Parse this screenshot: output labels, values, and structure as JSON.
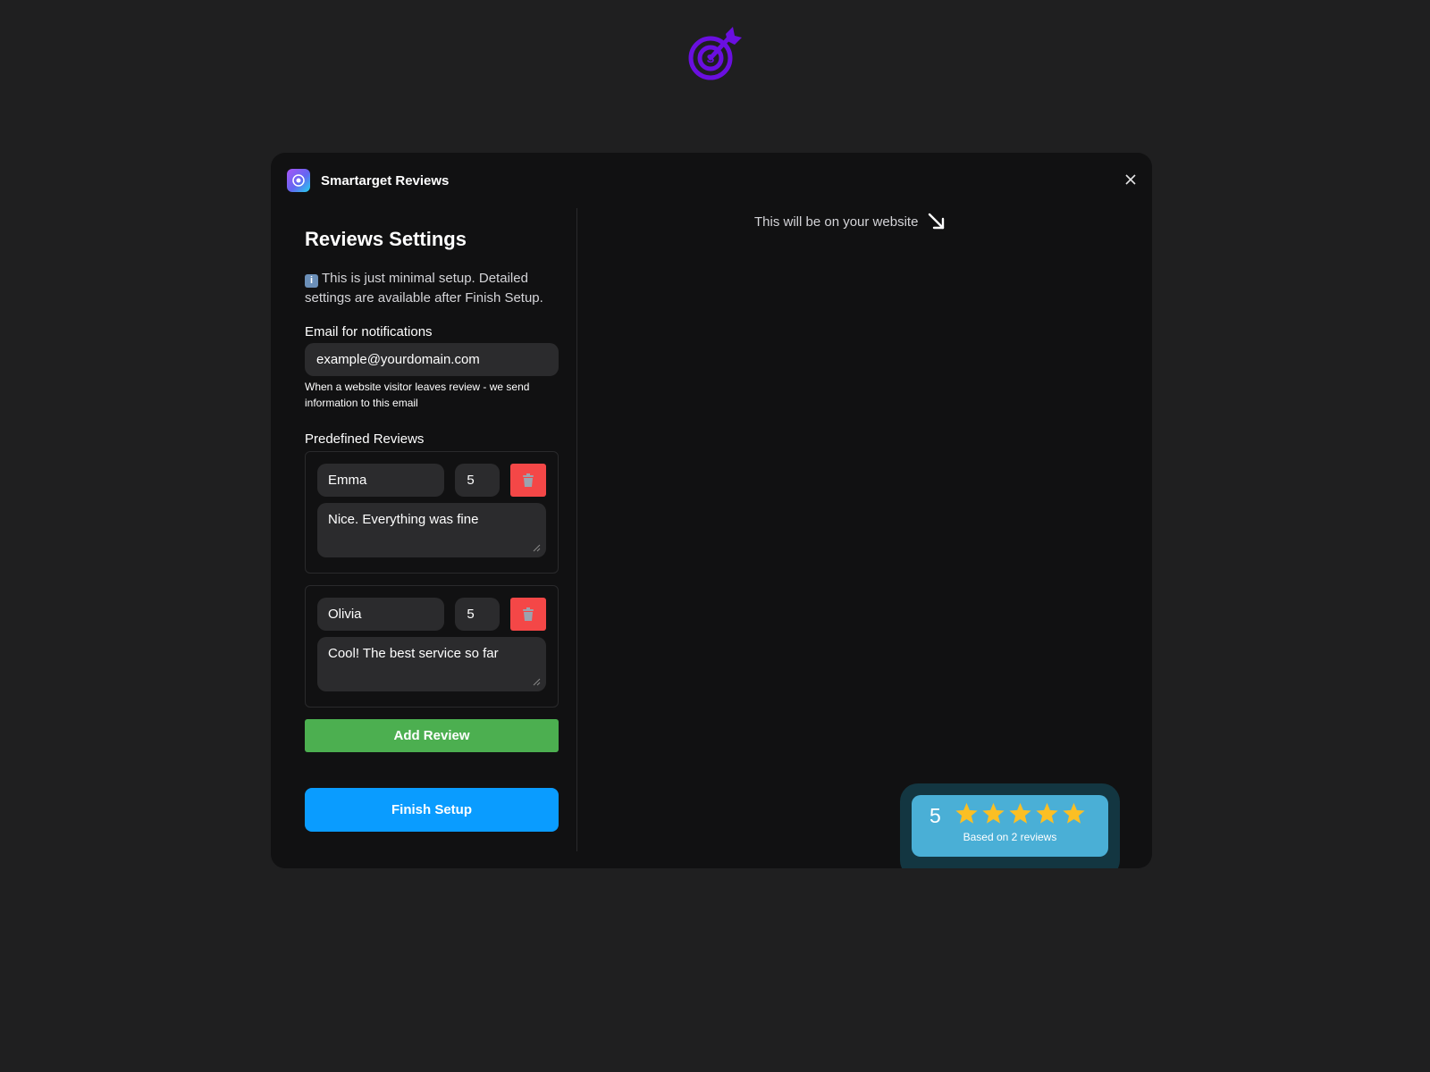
{
  "app": {
    "title": "Smartarget Reviews"
  },
  "settings": {
    "title": "Reviews Settings",
    "info_text": "This is just minimal setup. Detailed settings are available after Finish Setup."
  },
  "email": {
    "label": "Email for notifications",
    "value": "example@yourdomain.com",
    "help": "When a website visitor leaves review - we send information to this email"
  },
  "predefined": {
    "label": "Predefined Reviews",
    "reviews": [
      {
        "name": "Emma",
        "rating": "5",
        "text": "Nice. Everything was fine"
      },
      {
        "name": "Olivia",
        "rating": "5",
        "text": "Cool! The best service so far"
      }
    ]
  },
  "buttons": {
    "add_review": "Add Review",
    "finish_setup": "Finish Setup"
  },
  "preview": {
    "caption": "This will be on your website",
    "widget": {
      "score": "5",
      "stars": 5,
      "caption": "Based on 2 reviews"
    }
  },
  "colors": {
    "page_bg": "#1f1f20",
    "modal_bg": "#111112",
    "brand_purple": "#6d28d9",
    "add_green": "#4caf50",
    "finish_blue": "#0a9cff",
    "delete_red": "#f44747",
    "widget_blue": "#4aafd6",
    "star_gold": "#fbbf24"
  }
}
